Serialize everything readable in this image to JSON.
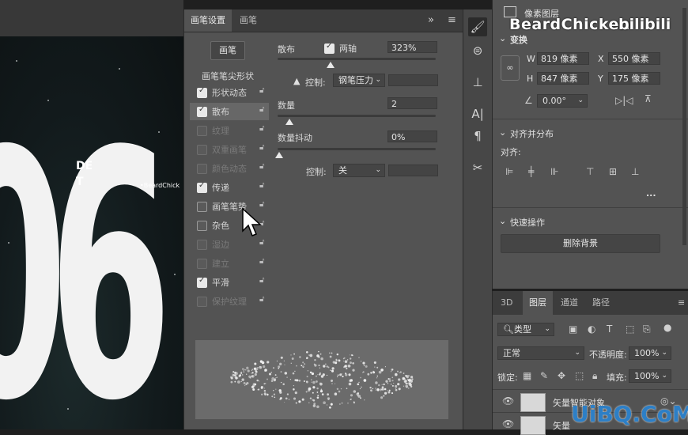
{
  "canvas": {
    "digits": [
      "0",
      "6"
    ],
    "text_line1": "DE",
    "text_line2": "T",
    "text_brand": "•BeardChick"
  },
  "brush_panel": {
    "tabs": [
      "画笔设置",
      "画笔"
    ],
    "collapse_icon": "»",
    "menu_icon": "≡",
    "brush_button": "画笔",
    "tip_shape_label": "画笔笔尖形状",
    "options": [
      {
        "label": "形状动态",
        "checked": true,
        "dim": false,
        "selected": false
      },
      {
        "label": "散布",
        "checked": true,
        "dim": false,
        "selected": true
      },
      {
        "label": "纹理",
        "checked": false,
        "dim": true,
        "selected": false
      },
      {
        "label": "双重画笔",
        "checked": false,
        "dim": true,
        "selected": false
      },
      {
        "label": "颜色动态",
        "checked": false,
        "dim": true,
        "selected": false
      },
      {
        "label": "传递",
        "checked": true,
        "dim": false,
        "selected": false
      },
      {
        "label": "画笔笔势",
        "checked": false,
        "dim": false,
        "selected": false
      },
      {
        "label": "杂色",
        "checked": false,
        "dim": false,
        "selected": false
      },
      {
        "label": "湿边",
        "checked": false,
        "dim": true,
        "selected": false
      },
      {
        "label": "建立",
        "checked": false,
        "dim": true,
        "selected": false
      },
      {
        "label": "平滑",
        "checked": true,
        "dim": false,
        "selected": false
      },
      {
        "label": "保护纹理",
        "checked": false,
        "dim": true,
        "selected": false
      }
    ],
    "lock_icon": "🔓",
    "scatter": {
      "label": "散布",
      "both_axes_label": "两轴",
      "both_axes_checked": true,
      "value": "323%"
    },
    "control1": {
      "warning_icon": "▲",
      "label": "控制:",
      "value": "钢笔压力"
    },
    "count": {
      "label": "数量",
      "value": "2"
    },
    "count_jitter": {
      "label": "数量抖动",
      "value": "0%"
    },
    "control2": {
      "label": "控制:",
      "value": "关"
    },
    "scatter_level": 0.2,
    "count_level": 0.0625,
    "count_jitter_level": 0.0
  },
  "tools": [
    "brush-settings-icon",
    "brush-presets-icon",
    "clone-source-icon",
    "character-icon",
    "paragraph-icon",
    "tool-presets-icon"
  ],
  "properties": {
    "layer_type_label": "像素图层",
    "transform": {
      "title": "变换",
      "W": {
        "label": "W",
        "value": "819 像素"
      },
      "X": {
        "label": "X",
        "value": "550 像素"
      },
      "H": {
        "label": "H",
        "value": "847 像素"
      },
      "Y": {
        "label": "Y",
        "value": "175 像素"
      },
      "angle": "0.00°"
    },
    "align": {
      "title": "对齐并分布",
      "sub": "对齐:",
      "more": "..."
    },
    "quick": {
      "title": "快速操作",
      "remove_bg": "删除背景"
    }
  },
  "layers_panel": {
    "tabs": [
      "3D",
      "图层",
      "通道",
      "路径"
    ],
    "filter_label": "类型",
    "blend_mode": "正常",
    "opacity_label": "不透明度:",
    "opacity_value": "100%",
    "lock_label": "锁定:",
    "fill_label": "填充:",
    "fill_value": "100%",
    "layer_rows": [
      "矢量智能对象",
      "矢量"
    ]
  },
  "watermark": {
    "name": "BeardChicken",
    "site": "bilibili",
    "corner": "UiBQ.CoM"
  }
}
